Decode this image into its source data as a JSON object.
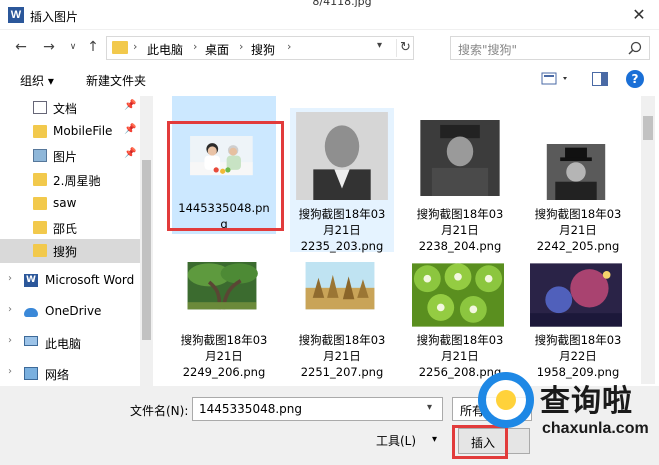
{
  "window": {
    "title": "插入图片",
    "app_icon": "W",
    "close_glyph": "✕"
  },
  "address": {
    "crumbs": [
      "此电脑",
      "桌面",
      "搜狗"
    ],
    "search_placeholder": "搜索\"搜狗\""
  },
  "toolbar": {
    "organize": "组织 ▾",
    "new_folder": "新建文件夹",
    "help": "?"
  },
  "nav": {
    "items": [
      {
        "label": "文档",
        "pinned": true
      },
      {
        "label": "MobileFile",
        "pinned": true
      },
      {
        "label": "图片",
        "pinned": true
      },
      {
        "label": "2.周星驰"
      },
      {
        "label": "saw"
      },
      {
        "label": "邵氏"
      },
      {
        "label": "搜狗",
        "selected": true
      },
      {
        "label": "Microsoft Word"
      },
      {
        "label": "OneDrive"
      },
      {
        "label": "此电脑"
      },
      {
        "label": "网络"
      }
    ]
  },
  "files": {
    "cut_top_label": "8/4118.jpg",
    "items": [
      {
        "name1": "1445335048.pn",
        "name2": "g",
        "selected": true
      },
      {
        "name1": "搜狗截图18年03",
        "name2": "月21日",
        "name3": "2235_203.png"
      },
      {
        "name1": "搜狗截图18年03",
        "name2": "月21日",
        "name3": "2238_204.png"
      },
      {
        "name1": "搜狗截图18年03",
        "name2": "月21日",
        "name3": "2242_205.png"
      },
      {
        "name1": "搜狗截图18年03",
        "name2": "月21日",
        "name3": "2249_206.png"
      },
      {
        "name1": "搜狗截图18年03",
        "name2": "月21日",
        "name3": "2251_207.png"
      },
      {
        "name1": "搜狗截图18年03",
        "name2": "月21日",
        "name3": "2256_208.png"
      },
      {
        "name1": "搜狗截图18年03",
        "name2": "月22日",
        "name3": "1958_209.png"
      }
    ]
  },
  "bottom": {
    "filename_label": "文件名(N):",
    "filename_value": "1445335048.png",
    "type_filter": "所有",
    "tools": "工具(L)",
    "insert": "插入"
  },
  "watermark": {
    "text": "查询啦",
    "url": "chaxunla.com"
  },
  "colors": {
    "highlight": "#e23b3b",
    "selection": "#cce8ff",
    "accent": "#1a6fd6"
  }
}
